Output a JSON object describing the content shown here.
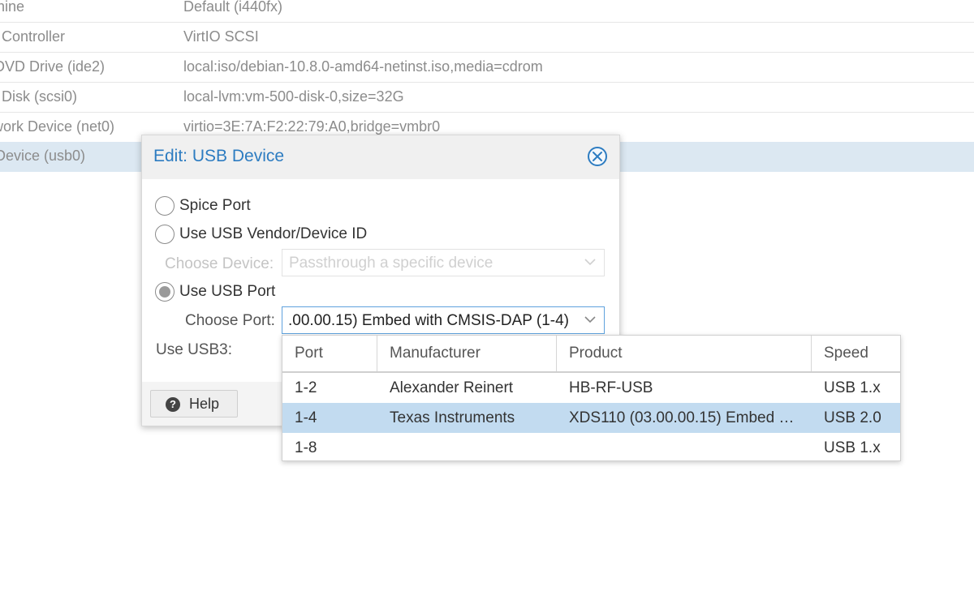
{
  "hardware_list": [
    {
      "key": "hine",
      "value": "Default (i440fx)"
    },
    {
      "key": "l Controller",
      "value": "VirtIO SCSI"
    },
    {
      "key": "DVD Drive (ide2)",
      "value": "local:iso/debian-10.8.0-amd64-netinst.iso,media=cdrom"
    },
    {
      "key": "l Disk (scsi0)",
      "value": "local-lvm:vm-500-disk-0,size=32G"
    },
    {
      "key": "work Device (net0)",
      "value": "virtio=3E:7A:F2:22:79:A0,bridge=vmbr0"
    },
    {
      "key": "Device (usb0)",
      "value": ""
    }
  ],
  "dialog": {
    "title": "Edit: USB Device",
    "radio_spice": "Spice Port",
    "radio_vendor": "Use USB Vendor/Device ID",
    "choose_device_label": "Choose Device:",
    "choose_device_placeholder": "Passthrough a specific device",
    "radio_port": "Use USB Port",
    "choose_port_label": "Choose Port:",
    "choose_port_value": ".00.00.15) Embed with CMSIS-DAP (1-4)",
    "usb3_label": "Use USB3:",
    "help_label": "Help",
    "selected_option": "Use USB Port"
  },
  "port_grid": {
    "columns": [
      "Port",
      "Manufacturer",
      "Product",
      "Speed"
    ],
    "rows": [
      {
        "port": "1-2",
        "manufacturer": "Alexander Reinert",
        "product": "HB-RF-USB",
        "speed": "USB 1.x"
      },
      {
        "port": "1-4",
        "manufacturer": "Texas Instruments",
        "product": "XDS110 (03.00.00.15) Embed …",
        "speed": "USB 2.0"
      },
      {
        "port": "1-8",
        "manufacturer": "",
        "product": "",
        "speed": "USB 1.x"
      }
    ],
    "selected_port": "1-4"
  },
  "colors": {
    "accent": "#2d7cc1",
    "selection": "#c2dbf0",
    "row_selection": "#dce8f2"
  },
  "icons": {
    "close": "close-circle-icon",
    "help": "question-circle-icon",
    "dropdown": "chevron-down-icon"
  }
}
